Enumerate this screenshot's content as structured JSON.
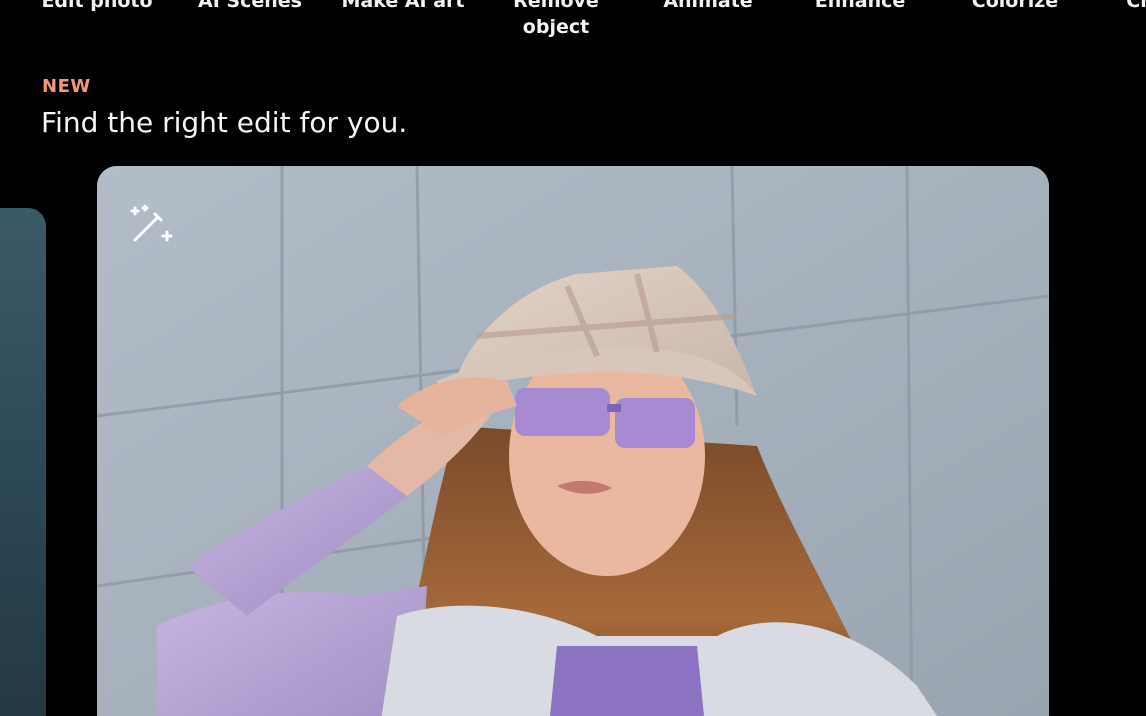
{
  "tools": [
    {
      "label": "Edit photo",
      "icon": "photo-edit-icon"
    },
    {
      "label": "AI Scenes",
      "icon": "scenes-icon"
    },
    {
      "label": "Make AI art",
      "icon": "ai-art-icon"
    },
    {
      "label": "Remove\nobject",
      "icon": "eraser-icon"
    },
    {
      "label": "Animate",
      "icon": "animate-icon"
    },
    {
      "label": "Enhance",
      "icon": "enhance-icon"
    },
    {
      "label": "Colorize",
      "icon": "colorize-icon"
    },
    {
      "label": "Ch",
      "icon": "unknown-icon"
    }
  ],
  "section": {
    "tag": "NEW",
    "title": "Find the right edit for you."
  },
  "hero": {
    "icon": "magic-wand-icon",
    "image": "Woman in a plaid bucket hat and lavender sunglasses against a gray wall"
  },
  "colors": {
    "background": "#000000",
    "accent_tag": "#f29a77",
    "text": "#f4f4f4"
  }
}
